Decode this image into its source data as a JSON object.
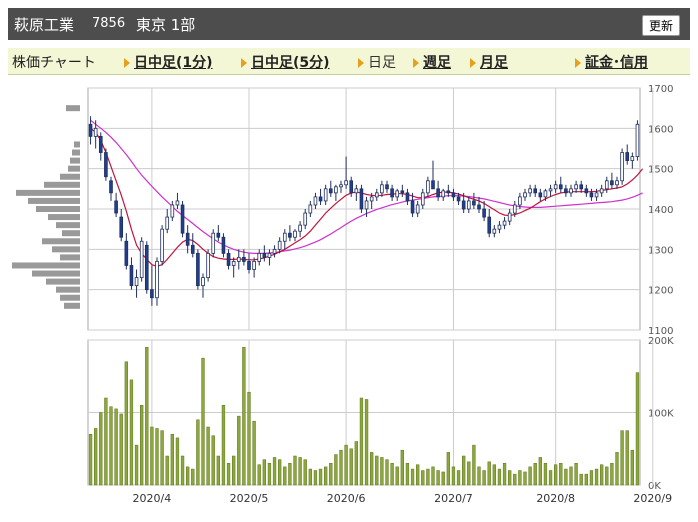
{
  "header": {
    "company": "萩原工業",
    "code": "7856",
    "market": "東京 1部",
    "refresh_label": "更新"
  },
  "tabs": [
    {
      "label": "株価チャート",
      "type": "title"
    },
    {
      "label": "日中足(1分)",
      "type": "link"
    },
    {
      "label": "日中足(5分)",
      "type": "link"
    },
    {
      "label": "日足",
      "type": "plain"
    },
    {
      "label": "週足",
      "type": "link"
    },
    {
      "label": "月足",
      "type": "link"
    },
    {
      "label": "証金･信用",
      "type": "link"
    }
  ],
  "colors": {
    "header_bg": "#4d4d4d",
    "up_candle": "#ffffff",
    "down_candle": "#1f3f8f",
    "ma_short": "#c0143c",
    "ma_long": "#cc33cc",
    "volume": "#8ca83a",
    "volume_profile": "#999999",
    "grid": "#cccccc",
    "accent_arrow": "#e6a11c"
  },
  "chart_data": [
    {
      "type": "candlestick",
      "title": "",
      "y_ticks": [
        1100,
        1200,
        1300,
        1400,
        1500,
        1600,
        1700
      ],
      "ylim": [
        1100,
        1700
      ],
      "x_labels": [
        "2020/4",
        "2020/5",
        "2020/6",
        "2020/7",
        "2020/8",
        "2020/9"
      ],
      "x_label_index": [
        12,
        31,
        50,
        71,
        91,
        110
      ],
      "ohlc": [
        [
          1610,
          1630,
          1560,
          1580
        ],
        [
          1580,
          1620,
          1550,
          1600
        ],
        [
          1580,
          1590,
          1520,
          1540
        ],
        [
          1540,
          1550,
          1470,
          1480
        ],
        [
          1470,
          1480,
          1420,
          1440
        ],
        [
          1420,
          1440,
          1380,
          1390
        ],
        [
          1380,
          1400,
          1320,
          1330
        ],
        [
          1320,
          1340,
          1250,
          1260
        ],
        [
          1260,
          1280,
          1200,
          1210
        ],
        [
          1210,
          1250,
          1180,
          1230
        ],
        [
          1230,
          1330,
          1220,
          1320
        ],
        [
          1310,
          1320,
          1190,
          1200
        ],
        [
          1200,
          1260,
          1160,
          1180
        ],
        [
          1180,
          1280,
          1160,
          1270
        ],
        [
          1270,
          1360,
          1260,
          1350
        ],
        [
          1350,
          1400,
          1340,
          1380
        ],
        [
          1380,
          1420,
          1370,
          1410
        ],
        [
          1410,
          1440,
          1400,
          1420
        ],
        [
          1410,
          1420,
          1330,
          1340
        ],
        [
          1340,
          1360,
          1290,
          1310
        ],
        [
          1310,
          1340,
          1280,
          1290
        ],
        [
          1290,
          1300,
          1200,
          1210
        ],
        [
          1210,
          1240,
          1180,
          1230
        ],
        [
          1230,
          1300,
          1220,
          1290
        ],
        [
          1290,
          1350,
          1280,
          1340
        ],
        [
          1340,
          1360,
          1320,
          1330
        ],
        [
          1330,
          1340,
          1280,
          1290
        ],
        [
          1290,
          1300,
          1250,
          1260
        ],
        [
          1260,
          1280,
          1230,
          1270
        ],
        [
          1270,
          1300,
          1250,
          1280
        ],
        [
          1280,
          1300,
          1260,
          1270
        ],
        [
          1270,
          1290,
          1240,
          1250
        ],
        [
          1250,
          1280,
          1230,
          1270
        ],
        [
          1270,
          1300,
          1260,
          1290
        ],
        [
          1290,
          1310,
          1270,
          1280
        ],
        [
          1280,
          1300,
          1260,
          1290
        ],
        [
          1290,
          1310,
          1280,
          1300
        ],
        [
          1300,
          1330,
          1290,
          1320
        ],
        [
          1320,
          1350,
          1300,
          1340
        ],
        [
          1340,
          1360,
          1320,
          1330
        ],
        [
          1330,
          1350,
          1320,
          1345
        ],
        [
          1345,
          1370,
          1330,
          1360
        ],
        [
          1360,
          1400,
          1350,
          1390
        ],
        [
          1390,
          1420,
          1380,
          1410
        ],
        [
          1410,
          1440,
          1400,
          1430
        ],
        [
          1430,
          1450,
          1410,
          1420
        ],
        [
          1420,
          1460,
          1410,
          1450
        ],
        [
          1450,
          1470,
          1430,
          1440
        ],
        [
          1440,
          1460,
          1420,
          1455
        ],
        [
          1455,
          1470,
          1440,
          1460
        ],
        [
          1460,
          1530,
          1450,
          1470
        ],
        [
          1470,
          1480,
          1430,
          1440
        ],
        [
          1440,
          1460,
          1420,
          1450
        ],
        [
          1450,
          1460,
          1390,
          1400
        ],
        [
          1400,
          1430,
          1380,
          1420
        ],
        [
          1420,
          1440,
          1400,
          1430
        ],
        [
          1430,
          1450,
          1420,
          1440
        ],
        [
          1440,
          1470,
          1430,
          1460
        ],
        [
          1460,
          1470,
          1440,
          1450
        ],
        [
          1450,
          1460,
          1420,
          1430
        ],
        [
          1430,
          1450,
          1420,
          1445
        ],
        [
          1445,
          1460,
          1430,
          1440
        ],
        [
          1440,
          1450,
          1410,
          1420
        ],
        [
          1420,
          1440,
          1380,
          1390
        ],
        [
          1390,
          1420,
          1380,
          1410
        ],
        [
          1410,
          1450,
          1400,
          1440
        ],
        [
          1440,
          1480,
          1430,
          1470
        ],
        [
          1470,
          1520,
          1460,
          1450
        ],
        [
          1450,
          1470,
          1420,
          1430
        ],
        [
          1430,
          1450,
          1420,
          1445
        ],
        [
          1445,
          1460,
          1430,
          1440
        ],
        [
          1440,
          1450,
          1420,
          1430
        ],
        [
          1430,
          1440,
          1410,
          1420
        ],
        [
          1420,
          1440,
          1390,
          1400
        ],
        [
          1400,
          1430,
          1390,
          1420
        ],
        [
          1420,
          1440,
          1400,
          1410
        ],
        [
          1410,
          1430,
          1390,
          1400
        ],
        [
          1400,
          1420,
          1370,
          1380
        ],
        [
          1380,
          1400,
          1330,
          1340
        ],
        [
          1340,
          1360,
          1330,
          1350
        ],
        [
          1350,
          1370,
          1340,
          1360
        ],
        [
          1360,
          1380,
          1350,
          1370
        ],
        [
          1370,
          1400,
          1360,
          1390
        ],
        [
          1390,
          1420,
          1380,
          1410
        ],
        [
          1410,
          1440,
          1400,
          1430
        ],
        [
          1430,
          1450,
          1420,
          1440
        ],
        [
          1440,
          1460,
          1430,
          1450
        ],
        [
          1450,
          1460,
          1430,
          1440
        ],
        [
          1440,
          1450,
          1420,
          1430
        ],
        [
          1430,
          1450,
          1420,
          1445
        ],
        [
          1445,
          1460,
          1430,
          1450
        ],
        [
          1450,
          1470,
          1440,
          1460
        ],
        [
          1460,
          1480,
          1440,
          1450
        ],
        [
          1450,
          1460,
          1430,
          1440
        ],
        [
          1440,
          1460,
          1430,
          1450
        ],
        [
          1450,
          1470,
          1440,
          1460
        ],
        [
          1460,
          1470,
          1440,
          1450
        ],
        [
          1450,
          1460,
          1430,
          1440
        ],
        [
          1440,
          1450,
          1420,
          1430
        ],
        [
          1430,
          1450,
          1420,
          1440
        ],
        [
          1440,
          1460,
          1430,
          1450
        ],
        [
          1450,
          1480,
          1440,
          1470
        ],
        [
          1470,
          1490,
          1450,
          1460
        ],
        [
          1460,
          1480,
          1450,
          1470
        ],
        [
          1470,
          1550,
          1460,
          1540
        ],
        [
          1540,
          1560,
          1510,
          1520
        ],
        [
          1520,
          1540,
          1500,
          1530
        ],
        [
          1530,
          1620,
          1520,
          1610
        ]
      ],
      "ma_short": [
        1600,
        1590,
        1570,
        1540,
        1505,
        1470,
        1435,
        1395,
        1350,
        1310,
        1290,
        1275,
        1262,
        1258,
        1262,
        1275,
        1290,
        1305,
        1318,
        1325,
        1322,
        1312,
        1300,
        1290,
        1282,
        1278,
        1276,
        1275,
        1275,
        1276,
        1275,
        1274,
        1274,
        1276,
        1279,
        1283,
        1288,
        1294,
        1300,
        1308,
        1316,
        1324,
        1333,
        1345,
        1360,
        1375,
        1390,
        1402,
        1414,
        1424,
        1434,
        1440,
        1442,
        1440,
        1436,
        1434,
        1433,
        1434,
        1436,
        1437,
        1438,
        1438,
        1436,
        1432,
        1428,
        1428,
        1431,
        1436,
        1440,
        1442,
        1442,
        1440,
        1437,
        1433,
        1428,
        1424,
        1420,
        1414,
        1406,
        1398,
        1390,
        1385,
        1384,
        1386,
        1390,
        1396,
        1402,
        1410,
        1418,
        1425,
        1431,
        1436,
        1440,
        1442,
        1443,
        1443,
        1443,
        1443,
        1443,
        1444,
        1446,
        1448,
        1450,
        1452,
        1455,
        1462,
        1472,
        1484,
        1500
      ],
      "ma_long": [
        1620,
        1610,
        1600,
        1590,
        1578,
        1565,
        1550,
        1535,
        1518,
        1500,
        1484,
        1470,
        1456,
        1443,
        1430,
        1418,
        1406,
        1394,
        1384,
        1374,
        1364,
        1354,
        1344,
        1335,
        1326,
        1318,
        1311,
        1305,
        1300,
        1296,
        1293,
        1291,
        1290,
        1290,
        1290,
        1291,
        1292,
        1294,
        1296,
        1298,
        1301,
        1304,
        1308,
        1313,
        1318,
        1324,
        1331,
        1338,
        1346,
        1354,
        1362,
        1370,
        1377,
        1383,
        1389,
        1394,
        1399,
        1403,
        1407,
        1411,
        1414,
        1417,
        1420,
        1422,
        1424,
        1426,
        1428,
        1430,
        1431,
        1432,
        1433,
        1433,
        1433,
        1432,
        1431,
        1429,
        1427,
        1425,
        1422,
        1419,
        1416,
        1413,
        1410,
        1408,
        1406,
        1405,
        1404,
        1404,
        1404,
        1405,
        1406,
        1407,
        1408,
        1409,
        1410,
        1411,
        1412,
        1413,
        1414,
        1415,
        1416,
        1417,
        1418,
        1420,
        1422,
        1425,
        1429,
        1434,
        1440
      ],
      "volume_profile": [
        {
          "price": 1650,
          "length": 14
        },
        {
          "price": 1560,
          "length": 6
        },
        {
          "price": 1540,
          "length": 8
        },
        {
          "price": 1520,
          "length": 10
        },
        {
          "price": 1500,
          "length": 12
        },
        {
          "price": 1480,
          "length": 20
        },
        {
          "price": 1460,
          "length": 36
        },
        {
          "price": 1440,
          "length": 64
        },
        {
          "price": 1420,
          "length": 52
        },
        {
          "price": 1400,
          "length": 44
        },
        {
          "price": 1380,
          "length": 32
        },
        {
          "price": 1360,
          "length": 24
        },
        {
          "price": 1340,
          "length": 18
        },
        {
          "price": 1320,
          "length": 38
        },
        {
          "price": 1300,
          "length": 28
        },
        {
          "price": 1280,
          "length": 20
        },
        {
          "price": 1260,
          "length": 68
        },
        {
          "price": 1240,
          "length": 48
        },
        {
          "price": 1220,
          "length": 34
        },
        {
          "price": 1200,
          "length": 24
        },
        {
          "price": 1180,
          "length": 20
        },
        {
          "price": 1160,
          "length": 16
        }
      ]
    },
    {
      "type": "bar",
      "title": "",
      "y_ticks": [
        "0K",
        "100K",
        "200K"
      ],
      "ylim": [
        0,
        200
      ],
      "unit": "K",
      "values": [
        70,
        78,
        100,
        120,
        108,
        105,
        98,
        170,
        145,
        55,
        110,
        190,
        80,
        78,
        75,
        40,
        70,
        65,
        40,
        25,
        22,
        90,
        175,
        80,
        68,
        40,
        110,
        30,
        40,
        95,
        190,
        128,
        88,
        28,
        35,
        30,
        38,
        35,
        25,
        30,
        40,
        38,
        35,
        22,
        20,
        22,
        25,
        30,
        42,
        48,
        55,
        50,
        60,
        120,
        118,
        45,
        40,
        38,
        35,
        30,
        25,
        48,
        30,
        22,
        28,
        20,
        22,
        25,
        20,
        18,
        45,
        25,
        20,
        40,
        32,
        55,
        25,
        20,
        32,
        28,
        22,
        30,
        20,
        15,
        20,
        18,
        25,
        30,
        38,
        30,
        20,
        28,
        30,
        22,
        25,
        30,
        15,
        15,
        20,
        22,
        28,
        25,
        30,
        45,
        75,
        75,
        48,
        155
      ]
    }
  ]
}
